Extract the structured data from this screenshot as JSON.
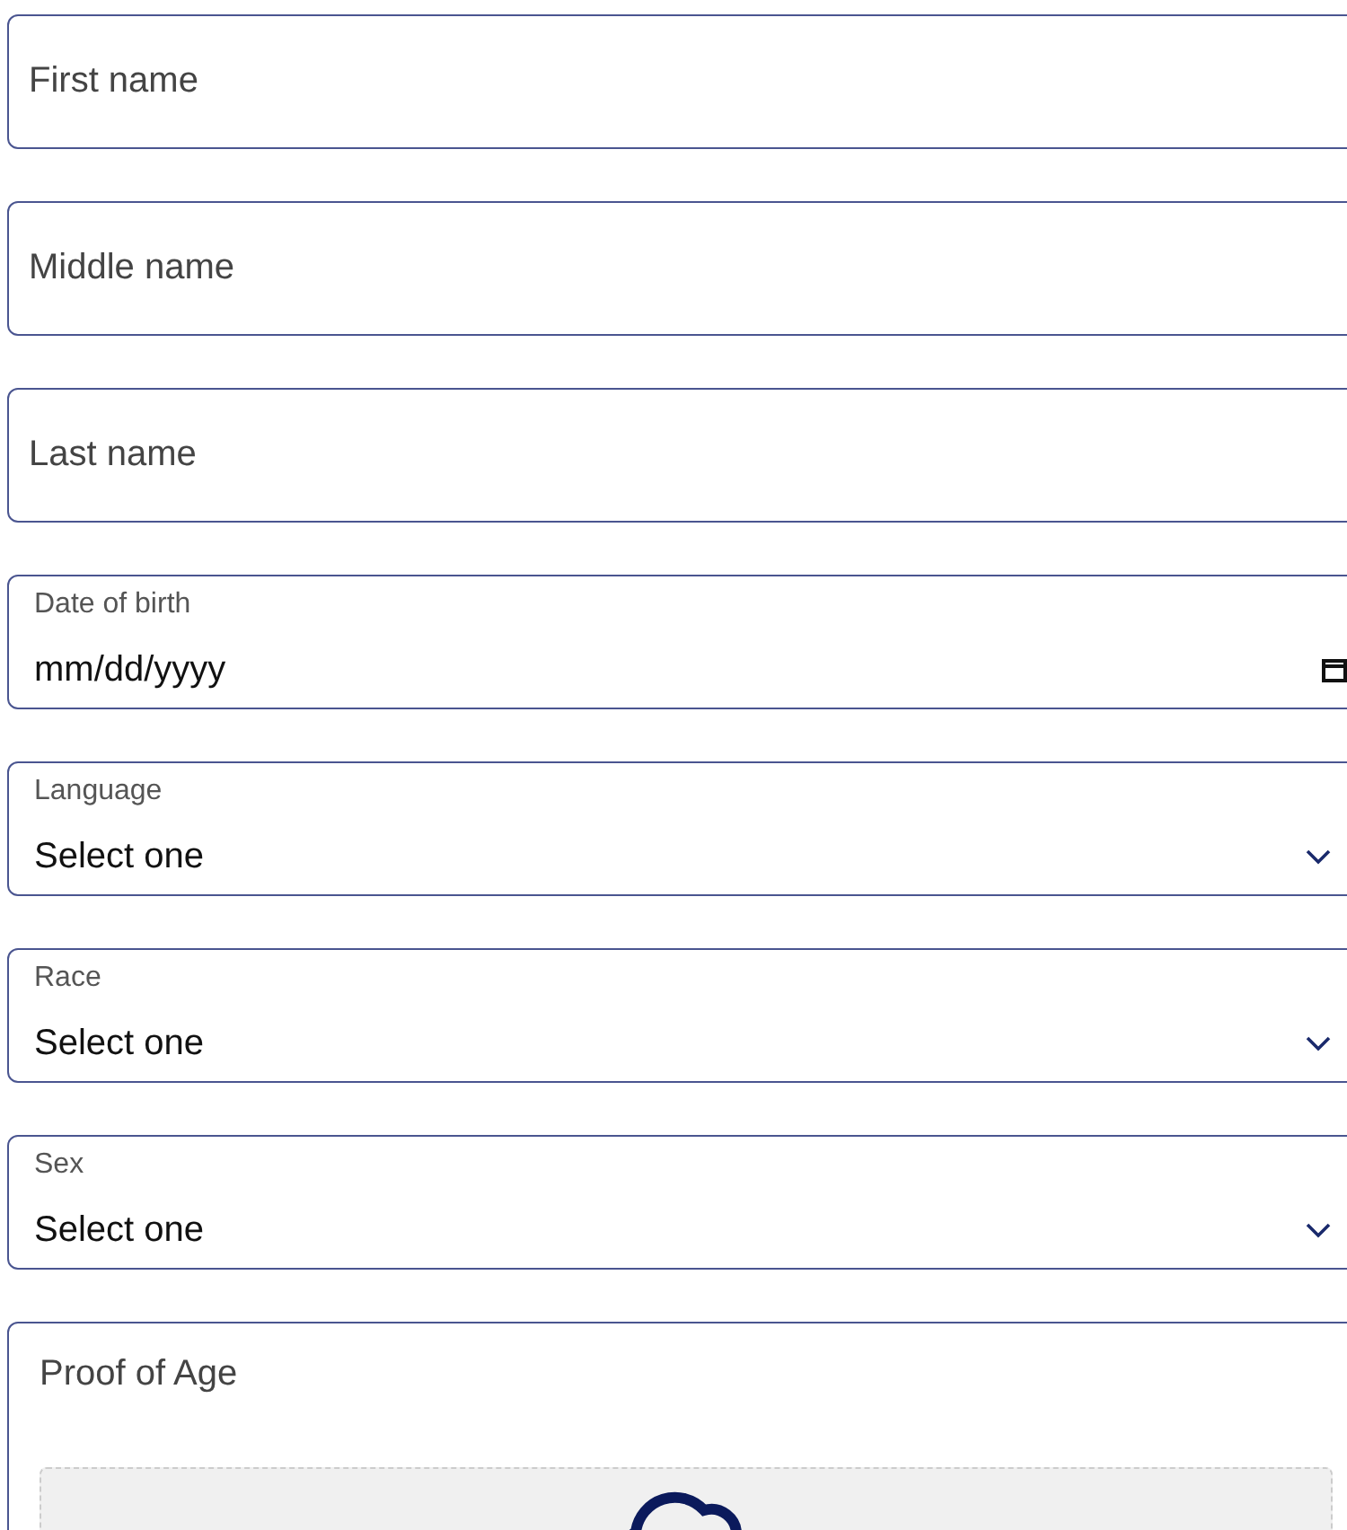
{
  "fields": [
    {
      "kind": "text",
      "placeholder": "First name"
    },
    {
      "kind": "text",
      "placeholder": "Middle name"
    },
    {
      "kind": "text",
      "placeholder": "Last name"
    },
    {
      "kind": "date",
      "label": "Date of birth",
      "value": "mm/dd/yyyy"
    },
    {
      "kind": "select",
      "label": "Language",
      "value": "Select one"
    },
    {
      "kind": "select",
      "label": "Race",
      "value": "Select one"
    },
    {
      "kind": "select",
      "label": "Sex",
      "value": "Select one"
    }
  ],
  "upload": {
    "title": "Proof of Age"
  }
}
